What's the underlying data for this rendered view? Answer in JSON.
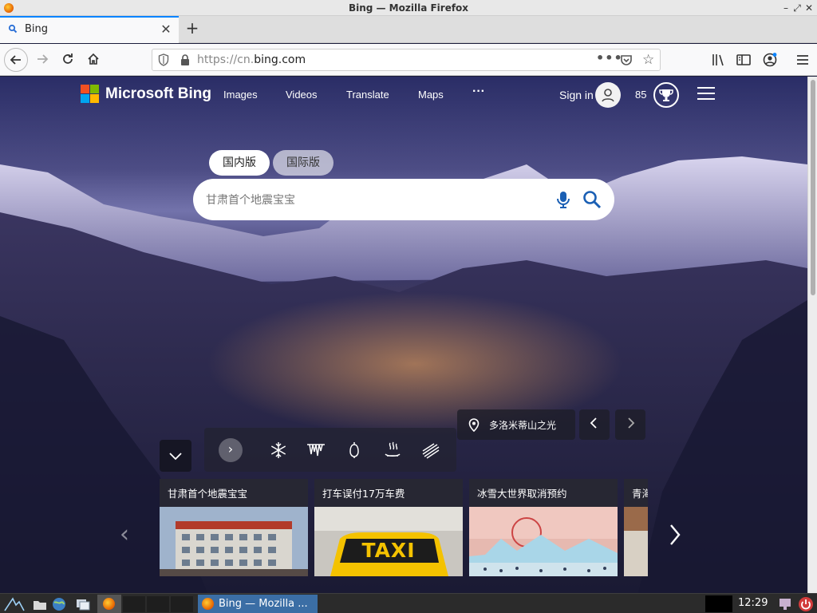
{
  "window": {
    "title": "Bing — Mozilla Firefox"
  },
  "tabs": [
    {
      "label": "Bing",
      "active": true
    }
  ],
  "navbar": {
    "url_prefix": "https://cn.",
    "url_host": "bing.com",
    "page_actions": "•••"
  },
  "bing": {
    "brand": "Microsoft Bing",
    "nav": [
      "Images",
      "Videos",
      "Translate",
      "Maps"
    ],
    "more": "···",
    "sign_in": "Sign in",
    "points": "85",
    "segments": {
      "domestic": "国内版",
      "international": "国际版"
    },
    "search_placeholder": "甘肃首个地震宝宝",
    "location": "多洛米蒂山之光",
    "cards": [
      {
        "title": "甘肃首个地震宝宝"
      },
      {
        "title": "打车误付17万车费"
      },
      {
        "title": "冰雪大世界取消预约"
      },
      {
        "title": "青海"
      }
    ],
    "taxi_text": "TAXI",
    "colors": {
      "ms_red": "#f25022",
      "ms_green": "#7fba00",
      "ms_blue": "#00a4ef",
      "ms_yellow": "#ffb900"
    }
  },
  "taskbar": {
    "active_task": "Bing — Mozilla ...",
    "clock": "12:29"
  }
}
